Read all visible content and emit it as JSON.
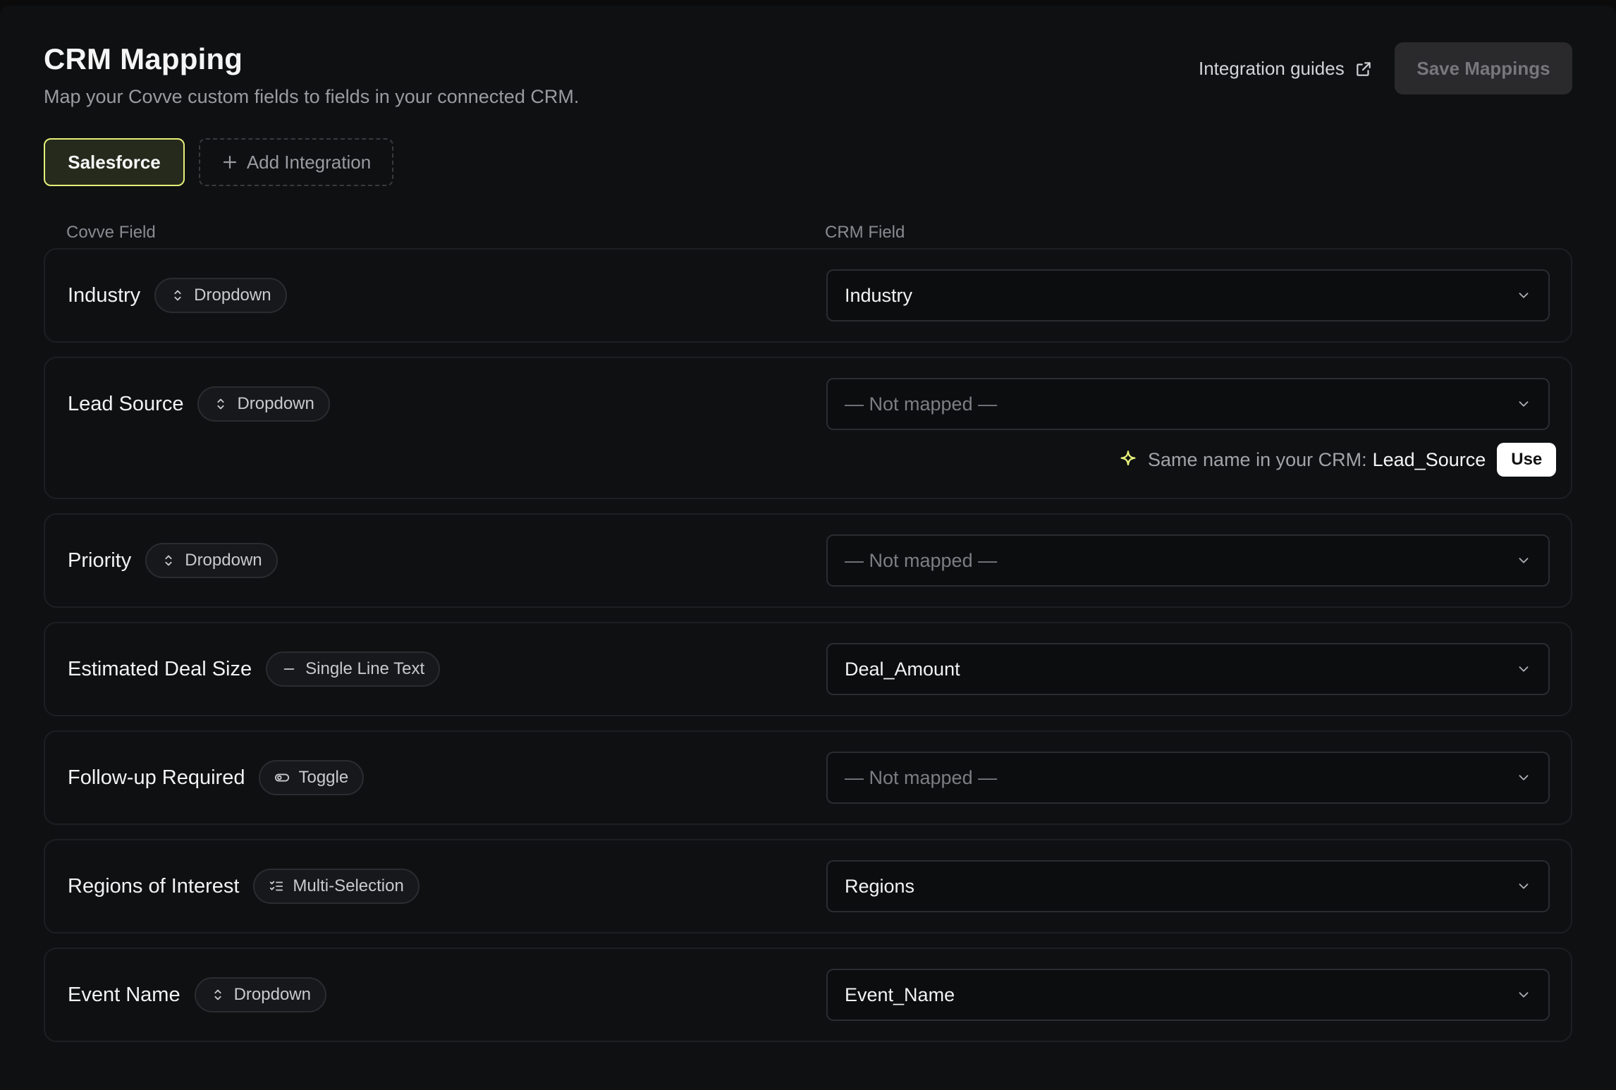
{
  "header": {
    "title": "CRM Mapping",
    "subtitle": "Map your Covve custom fields to fields in your connected CRM.",
    "guides_label": "Integration guides",
    "save_label": "Save Mappings"
  },
  "tabs": {
    "active": "Salesforce",
    "add_label": "Add Integration"
  },
  "columns": {
    "left": "Covve Field",
    "right": "CRM Field"
  },
  "rows": [
    {
      "name": "Industry",
      "type": "Dropdown",
      "type_icon": "sort-arrows-icon",
      "crm": "Industry"
    },
    {
      "name": "Lead Source",
      "type": "Dropdown",
      "type_icon": "sort-arrows-icon",
      "crm": "— Not mapped —",
      "suggestion": {
        "text": "Same name in your CRM:",
        "match": "Lead_Source",
        "action": "Use"
      }
    },
    {
      "name": "Priority",
      "type": "Dropdown",
      "type_icon": "sort-arrows-icon",
      "crm": "— Not mapped —"
    },
    {
      "name": "Estimated Deal Size",
      "type": "Single Line Text",
      "type_icon": "dash-icon",
      "crm": "Deal_Amount"
    },
    {
      "name": "Follow-up Required",
      "type": "Toggle",
      "type_icon": "toggle-icon",
      "crm": "— Not mapped —"
    },
    {
      "name": "Regions of Interest",
      "type": "Multi-Selection",
      "type_icon": "checklist-icon",
      "crm": "Regions"
    },
    {
      "name": "Event Name",
      "type": "Dropdown",
      "type_icon": "sort-arrows-icon",
      "crm": "Event_Name"
    }
  ],
  "colors": {
    "accent": "#e6f07a",
    "background": "#0f1012",
    "border": "#1e1f22"
  }
}
